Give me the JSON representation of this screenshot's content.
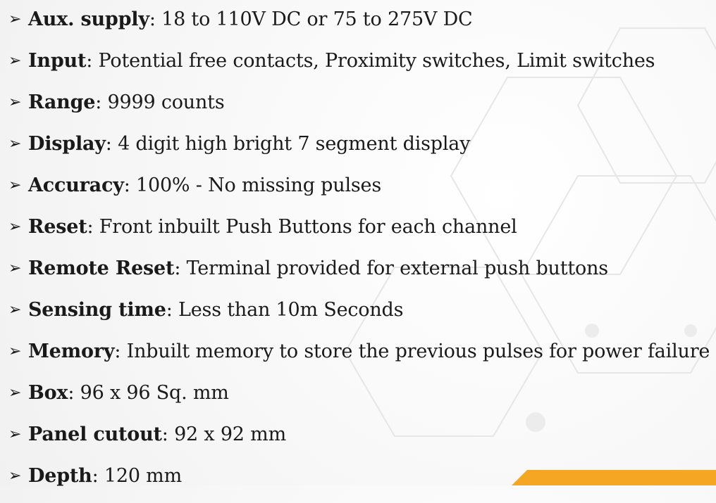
{
  "bullet_glyph": "➢",
  "accent_color": "#f5a623",
  "specs": [
    {
      "label": "Aux. supply",
      "value": ": 18 to 110V DC or 75 to 275V DC"
    },
    {
      "label": "Input",
      "value": ": Potential free contacts, Proximity switches, Limit switches"
    },
    {
      "label": "Range",
      "value": ": 9999 counts"
    },
    {
      "label": "Display",
      "value": ": 4 digit high bright 7 segment display"
    },
    {
      "label": "Accuracy",
      "value": ": 100% - No missing pulses"
    },
    {
      "label": "Reset",
      "value": ": Front inbuilt Push Buttons for each channel"
    },
    {
      "label": "Remote Reset",
      "value": ": Terminal provided for external push buttons"
    },
    {
      "label": "Sensing time",
      "value": ": Less than 10m Seconds"
    },
    {
      "label": "Memory",
      "value": ": Inbuilt memory to store the previous pulses for power failure"
    },
    {
      "label": "Box",
      "value": ": 96 x 96 Sq. mm"
    },
    {
      "label": "Panel cutout",
      "value": ": 92 x 92 mm"
    },
    {
      "label": "Depth",
      "value": ": 120 mm"
    }
  ]
}
